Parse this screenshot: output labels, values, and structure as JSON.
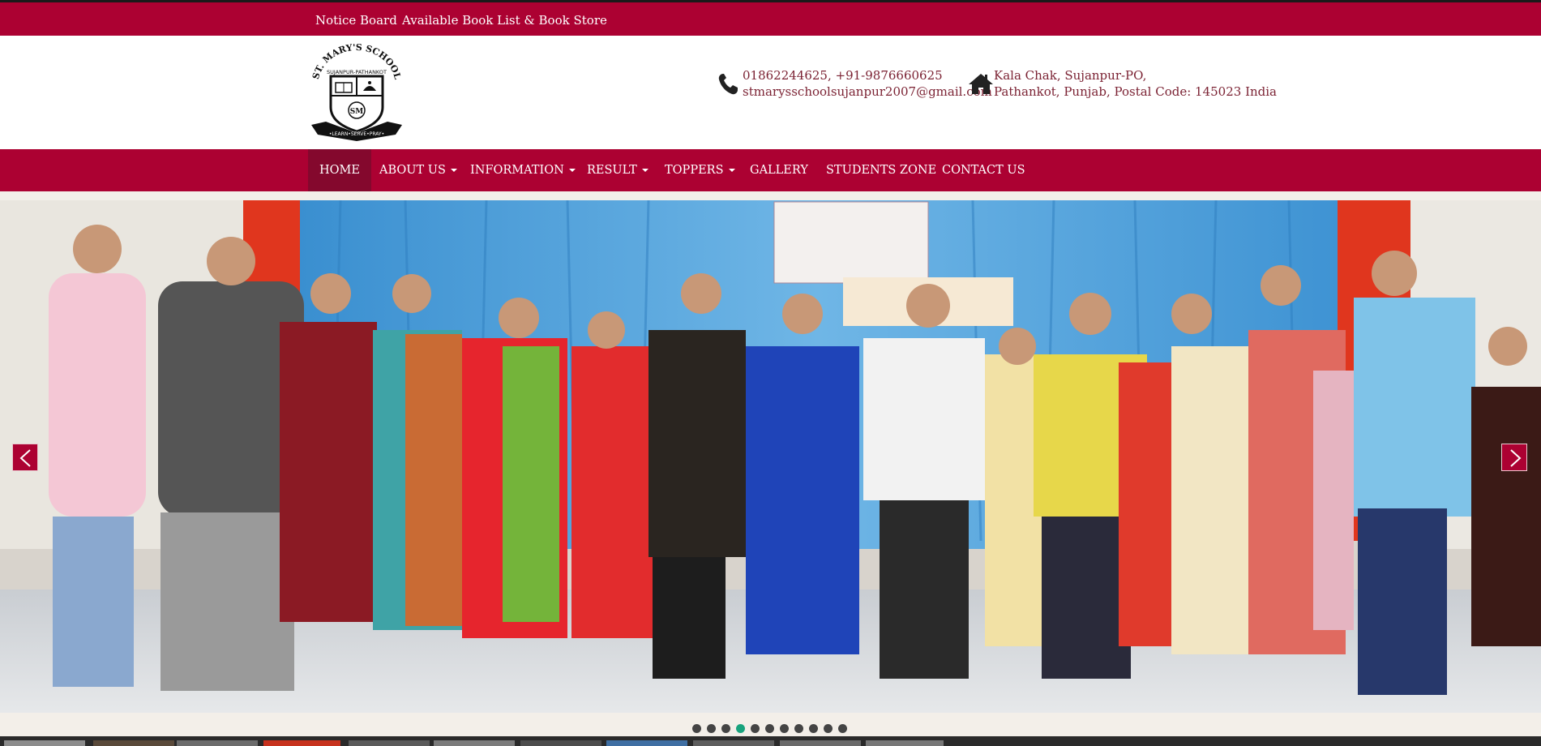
{
  "topbar": {
    "links": [
      "Notice Board",
      "Available Book List & Book Store"
    ]
  },
  "header": {
    "logo": {
      "arc_text": "ST. MARY'S SCHOOL",
      "sub_text": "SUJANPUR-PATHANKOT",
      "motto": "•LEARN•SERVE•PRAY•"
    },
    "phone_line": "01862244625, +91-9876660625",
    "email_line": "stmarysschoolsujanpur2007@gmail.com",
    "address_line1": "Kala Chak, Sujanpur-PO,",
    "address_line2": "Pathankot, Punjab, Postal Code: 145023 India"
  },
  "nav": {
    "items": [
      {
        "label": "HOME",
        "active": true,
        "dropdown": false
      },
      {
        "label": "ABOUT US",
        "active": false,
        "dropdown": true
      },
      {
        "label": "INFORMATION",
        "active": false,
        "dropdown": true
      },
      {
        "label": "RESULT",
        "active": false,
        "dropdown": true
      },
      {
        "label": "TOPPERS",
        "active": false,
        "dropdown": true
      },
      {
        "label": "GALLERY",
        "active": false,
        "dropdown": false
      },
      {
        "label": "STUDENTS ZONE",
        "active": false,
        "dropdown": false
      },
      {
        "label": "CONTACT US",
        "active": false,
        "dropdown": false
      }
    ]
  },
  "slider": {
    "slide_count": 11,
    "active_index": 3
  },
  "colors": {
    "brand": "#ac0132",
    "brand_dark": "#84082d",
    "dot_active": "#18a37d",
    "dot": "#444444"
  },
  "icons": {
    "phone": "phone-icon",
    "address": "home-icon",
    "prev": "chevron-left-icon",
    "next": "chevron-right-icon"
  }
}
